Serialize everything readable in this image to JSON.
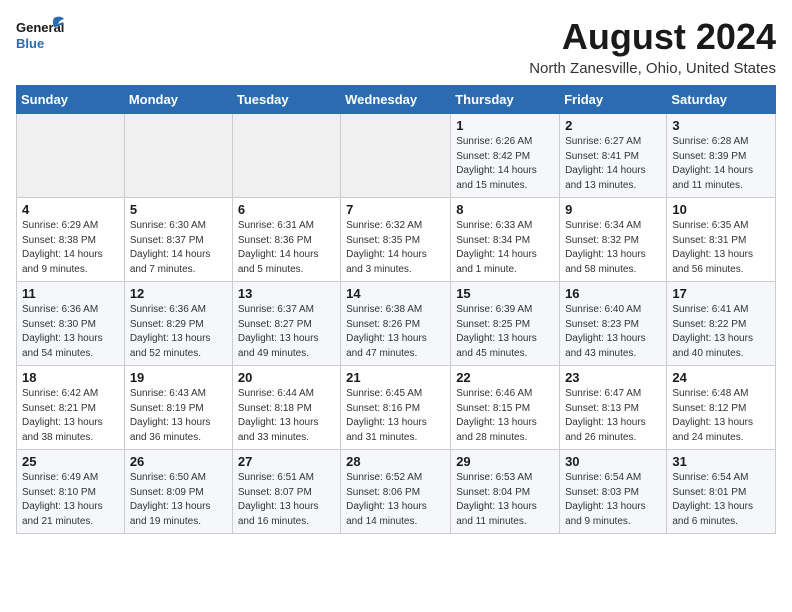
{
  "logo": {
    "line1": "General",
    "line2": "Blue"
  },
  "title": "August 2024",
  "subtitle": "North Zanesville, Ohio, United States",
  "days_of_week": [
    "Sunday",
    "Monday",
    "Tuesday",
    "Wednesday",
    "Thursday",
    "Friday",
    "Saturday"
  ],
  "weeks": [
    [
      {
        "day": "",
        "info": ""
      },
      {
        "day": "",
        "info": ""
      },
      {
        "day": "",
        "info": ""
      },
      {
        "day": "",
        "info": ""
      },
      {
        "day": "1",
        "info": "Sunrise: 6:26 AM\nSunset: 8:42 PM\nDaylight: 14 hours\nand 15 minutes."
      },
      {
        "day": "2",
        "info": "Sunrise: 6:27 AM\nSunset: 8:41 PM\nDaylight: 14 hours\nand 13 minutes."
      },
      {
        "day": "3",
        "info": "Sunrise: 6:28 AM\nSunset: 8:39 PM\nDaylight: 14 hours\nand 11 minutes."
      }
    ],
    [
      {
        "day": "4",
        "info": "Sunrise: 6:29 AM\nSunset: 8:38 PM\nDaylight: 14 hours\nand 9 minutes."
      },
      {
        "day": "5",
        "info": "Sunrise: 6:30 AM\nSunset: 8:37 PM\nDaylight: 14 hours\nand 7 minutes."
      },
      {
        "day": "6",
        "info": "Sunrise: 6:31 AM\nSunset: 8:36 PM\nDaylight: 14 hours\nand 5 minutes."
      },
      {
        "day": "7",
        "info": "Sunrise: 6:32 AM\nSunset: 8:35 PM\nDaylight: 14 hours\nand 3 minutes."
      },
      {
        "day": "8",
        "info": "Sunrise: 6:33 AM\nSunset: 8:34 PM\nDaylight: 14 hours\nand 1 minute."
      },
      {
        "day": "9",
        "info": "Sunrise: 6:34 AM\nSunset: 8:32 PM\nDaylight: 13 hours\nand 58 minutes."
      },
      {
        "day": "10",
        "info": "Sunrise: 6:35 AM\nSunset: 8:31 PM\nDaylight: 13 hours\nand 56 minutes."
      }
    ],
    [
      {
        "day": "11",
        "info": "Sunrise: 6:36 AM\nSunset: 8:30 PM\nDaylight: 13 hours\nand 54 minutes."
      },
      {
        "day": "12",
        "info": "Sunrise: 6:36 AM\nSunset: 8:29 PM\nDaylight: 13 hours\nand 52 minutes."
      },
      {
        "day": "13",
        "info": "Sunrise: 6:37 AM\nSunset: 8:27 PM\nDaylight: 13 hours\nand 49 minutes."
      },
      {
        "day": "14",
        "info": "Sunrise: 6:38 AM\nSunset: 8:26 PM\nDaylight: 13 hours\nand 47 minutes."
      },
      {
        "day": "15",
        "info": "Sunrise: 6:39 AM\nSunset: 8:25 PM\nDaylight: 13 hours\nand 45 minutes."
      },
      {
        "day": "16",
        "info": "Sunrise: 6:40 AM\nSunset: 8:23 PM\nDaylight: 13 hours\nand 43 minutes."
      },
      {
        "day": "17",
        "info": "Sunrise: 6:41 AM\nSunset: 8:22 PM\nDaylight: 13 hours\nand 40 minutes."
      }
    ],
    [
      {
        "day": "18",
        "info": "Sunrise: 6:42 AM\nSunset: 8:21 PM\nDaylight: 13 hours\nand 38 minutes."
      },
      {
        "day": "19",
        "info": "Sunrise: 6:43 AM\nSunset: 8:19 PM\nDaylight: 13 hours\nand 36 minutes."
      },
      {
        "day": "20",
        "info": "Sunrise: 6:44 AM\nSunset: 8:18 PM\nDaylight: 13 hours\nand 33 minutes."
      },
      {
        "day": "21",
        "info": "Sunrise: 6:45 AM\nSunset: 8:16 PM\nDaylight: 13 hours\nand 31 minutes."
      },
      {
        "day": "22",
        "info": "Sunrise: 6:46 AM\nSunset: 8:15 PM\nDaylight: 13 hours\nand 28 minutes."
      },
      {
        "day": "23",
        "info": "Sunrise: 6:47 AM\nSunset: 8:13 PM\nDaylight: 13 hours\nand 26 minutes."
      },
      {
        "day": "24",
        "info": "Sunrise: 6:48 AM\nSunset: 8:12 PM\nDaylight: 13 hours\nand 24 minutes."
      }
    ],
    [
      {
        "day": "25",
        "info": "Sunrise: 6:49 AM\nSunset: 8:10 PM\nDaylight: 13 hours\nand 21 minutes."
      },
      {
        "day": "26",
        "info": "Sunrise: 6:50 AM\nSunset: 8:09 PM\nDaylight: 13 hours\nand 19 minutes."
      },
      {
        "day": "27",
        "info": "Sunrise: 6:51 AM\nSunset: 8:07 PM\nDaylight: 13 hours\nand 16 minutes."
      },
      {
        "day": "28",
        "info": "Sunrise: 6:52 AM\nSunset: 8:06 PM\nDaylight: 13 hours\nand 14 minutes."
      },
      {
        "day": "29",
        "info": "Sunrise: 6:53 AM\nSunset: 8:04 PM\nDaylight: 13 hours\nand 11 minutes."
      },
      {
        "day": "30",
        "info": "Sunrise: 6:54 AM\nSunset: 8:03 PM\nDaylight: 13 hours\nand 9 minutes."
      },
      {
        "day": "31",
        "info": "Sunrise: 6:54 AM\nSunset: 8:01 PM\nDaylight: 13 hours\nand 6 minutes."
      }
    ]
  ]
}
